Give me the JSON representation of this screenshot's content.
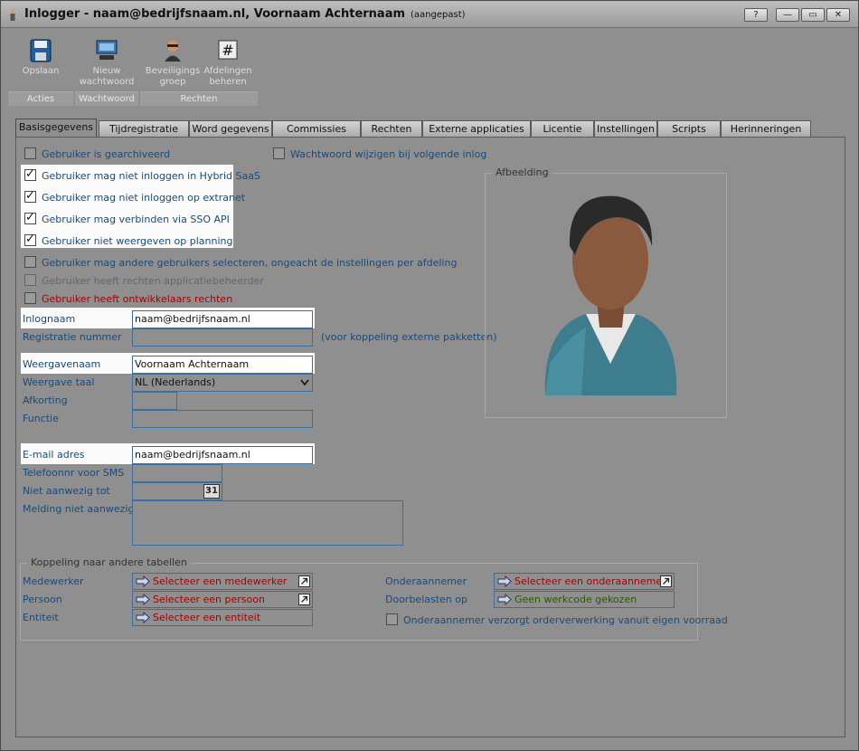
{
  "window": {
    "title": "Inlogger - naam@bedrijfsnaam.nl, Voornaam Achternaam",
    "title_suffix": "(aangepast)",
    "help_label": "?",
    "min_label": "—",
    "max_label": "▭",
    "close_label": "✕"
  },
  "ribbon": {
    "buttons": [
      {
        "label": "Opslaan",
        "icon": "floppy-disk-icon"
      },
      {
        "label": "Nieuw wachtwoord",
        "icon": "keyboard-icon"
      },
      {
        "label": "Beveiligings groep",
        "icon": "user-security-icon"
      },
      {
        "label": "Afdelingen beheren",
        "icon": "hash-icon"
      }
    ],
    "groups": [
      "Acties",
      "Wachtwoord",
      "Rechten"
    ]
  },
  "tabs": [
    "Basisgegevens",
    "Tijdregistratie",
    "Word gegevens",
    "Commissies",
    "Rechten",
    "Externe applicaties",
    "Licentie",
    "Instellingen",
    "Scripts",
    "Herinneringen"
  ],
  "checkboxes": {
    "gearchiveerd": "Gebruiker is gearchiveerd",
    "wachtwoord_wijzigen": "Wachtwoord wijzigen bij volgende inlog",
    "hybrid_saas": "Gebruiker mag niet inloggen in Hybrid SaaS",
    "extranet": "Gebruiker mag niet inloggen op extranet",
    "sso": "Gebruiker mag verbinden via SSO API",
    "planning": "Gebruiker niet weergeven op planning",
    "andere_gebruikers": "Gebruiker mag andere gebruikers selecteren, ongeacht de instellingen per afdeling",
    "applicatiebeheerder": "Gebruiker heeft rechten applicatiebeheerder",
    "ontwikkelaars": "Gebruiker heeft ontwikkelaars rechten"
  },
  "form": {
    "inlognaam_label": "Inlognaam",
    "inlognaam_value": "naam@bedrijfsnaam.nl",
    "registratie_label": "Registratie nummer",
    "registratie_hint": "(voor koppeling externe pakketten)",
    "weergavenaam_label": "Weergavenaam",
    "weergavenaam_value": "Voornaam Achternaam",
    "taal_label": "Weergave taal",
    "taal_value": "NL (Nederlands)",
    "afkorting_label": "Afkorting",
    "functie_label": "Functie",
    "email_label": "E-mail adres",
    "email_value": "naam@bedrijfsnaam.nl",
    "sms_label": "Telefoonnr voor SMS",
    "afwezig_label": "Niet aanwezig tot",
    "calendar_label": "31",
    "melding_label": "Melding niet aanwezig"
  },
  "afbeelding": {
    "title": "Afbeelding"
  },
  "koppeling": {
    "title": "Koppeling naar andere tabellen",
    "medewerker_label": "Medewerker",
    "medewerker_value": "Selecteer een medewerker",
    "persoon_label": "Persoon",
    "persoon_value": "Selecteer een persoon",
    "entiteit_label": "Entiteit",
    "entiteit_value": "Selecteer een entiteit",
    "onderaannemer_label": "Onderaannemer",
    "onderaannemer_value": "Selecteer een onderaannemer",
    "doorbelasten_label": "Doorbelasten op",
    "doorbelasten_value": "Geen werkcode gekozen",
    "voorraad_label": "Onderaannemer verzorgt orderverwerking vanuit eigen voorraad"
  }
}
